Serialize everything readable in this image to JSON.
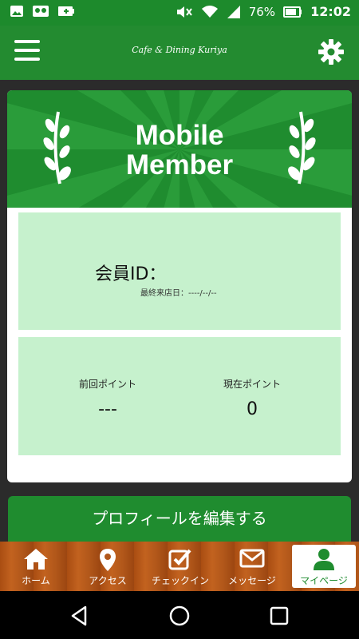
{
  "status_bar": {
    "battery_percent": "76%",
    "time": "12:02"
  },
  "app_bar": {
    "title": "Cafe & Dining Kuriya"
  },
  "card": {
    "banner_title": "Mobile\nMember",
    "member_id_label": "会員ID：",
    "member_id_value": "",
    "last_visit": "最終来店日：----/--/--",
    "previous_points_label": "前回ポイント",
    "previous_points_value": "---",
    "current_points_label": "現在ポイント",
    "current_points_value": "0"
  },
  "edit_profile_label": "プロフィールを編集する",
  "tabs": [
    {
      "label": "ホーム",
      "icon": "home-icon"
    },
    {
      "label": "アクセス",
      "icon": "map-pin-icon"
    },
    {
      "label": "チェックイン",
      "icon": "checkbox-icon"
    },
    {
      "label": "メッセージ",
      "icon": "envelope-icon"
    },
    {
      "label": "マイページ",
      "icon": "user-icon",
      "active": true
    }
  ],
  "colors": {
    "primary_green": "#1f8c2f",
    "panel_green": "#c6f1cd",
    "wood_brown": "#b1571a"
  }
}
